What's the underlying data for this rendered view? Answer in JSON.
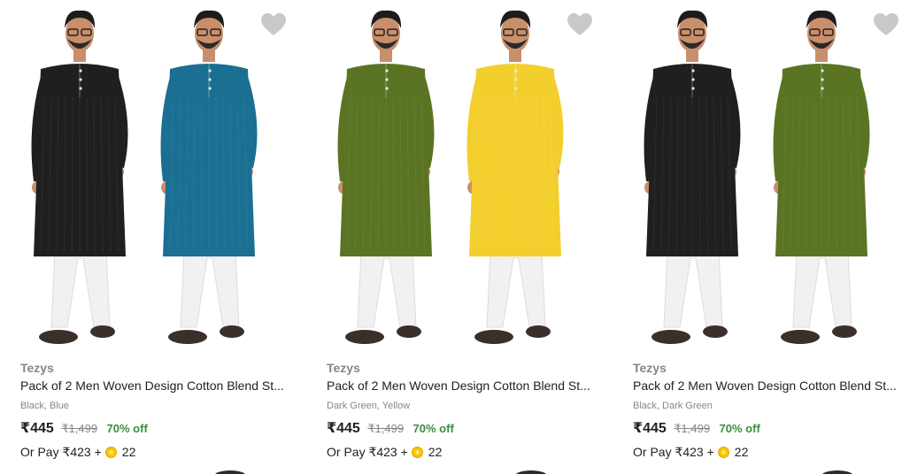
{
  "products": [
    {
      "brand": "Tezys",
      "title": "Pack of 2 Men Woven Design Cotton Blend St...",
      "colors": "Black, Blue",
      "price": "₹445",
      "mrp": "₹1,499",
      "discount": "70% off",
      "pay_text": "Or Pay ₹423 +",
      "coins": "22",
      "kurta_colors": [
        "#1f1f1f",
        "#1a6f92"
      ]
    },
    {
      "brand": "Tezys",
      "title": "Pack of 2 Men Woven Design Cotton Blend St...",
      "colors": "Dark Green, Yellow",
      "price": "₹445",
      "mrp": "₹1,499",
      "discount": "70% off",
      "pay_text": "Or Pay ₹423 +",
      "coins": "22",
      "kurta_colors": [
        "#5a7424",
        "#f3cf2e"
      ]
    },
    {
      "brand": "Tezys",
      "title": "Pack of 2 Men Woven Design Cotton Blend St...",
      "colors": "Black, Dark Green",
      "price": "₹445",
      "mrp": "₹1,499",
      "discount": "70% off",
      "pay_text": "Or Pay ₹423 +",
      "coins": "22",
      "kurta_colors": [
        "#1f1f1f",
        "#5a7424"
      ]
    }
  ],
  "icons": {
    "wishlist": "heart-icon",
    "coin": "supercoin-icon"
  },
  "theme": {
    "discount_color": "#388e3c",
    "muted_text": "#878787",
    "heart_color": "#c2c2c2"
  }
}
